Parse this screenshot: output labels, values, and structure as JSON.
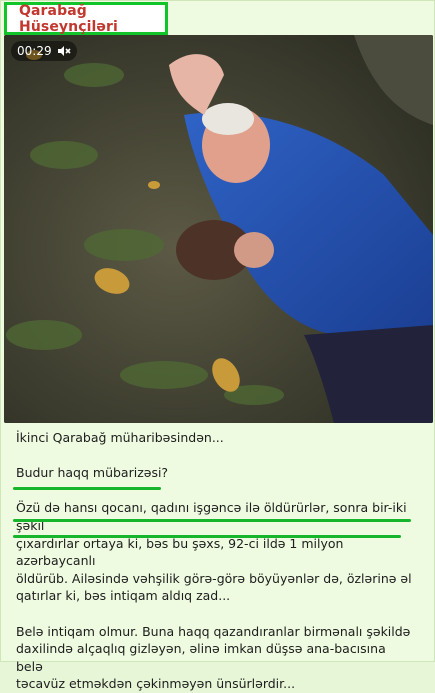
{
  "channel": {
    "name": "Qarabağ Hüseynçiləri"
  },
  "video": {
    "duration": "00:29",
    "sound_icon": "muted-speaker-icon"
  },
  "post": {
    "line1": "İkinci Qarabağ müharibəsindən...",
    "line2": "Budur haqq mübarizəsi?",
    "para3_l1": "Özü də hansı qocanı, qadını işgəncə ilə öldürürlər, sonra bir-iki şəkil",
    "para3_l2": "çıxardırlar ortaya ki, bəs bu şəxs, 92-ci ildə 1 milyon azərbaycanlı",
    "para3_l3": "öldürüb. Ailəsində vəhşilik görə-görə böyüyənlər də, özlərinə əl",
    "para3_l4": "qatırlar ki, bəs intiqam aldıq zad...",
    "para4_l1": "Belə intiqam olmur. Buna haqq qazandıranlar birmənalı şəkildə",
    "para4_l2": "daxilində alçaqlıq gizləyən, əlinə imkan düşsə ana-bacısına belə",
    "para4_l3": "təcavüz etməkdən çəkinməyən ünsürlərdir..."
  },
  "colors": {
    "highlight": "#10c42a",
    "channel_name": "#c1382e",
    "background": "#eefbe0"
  }
}
